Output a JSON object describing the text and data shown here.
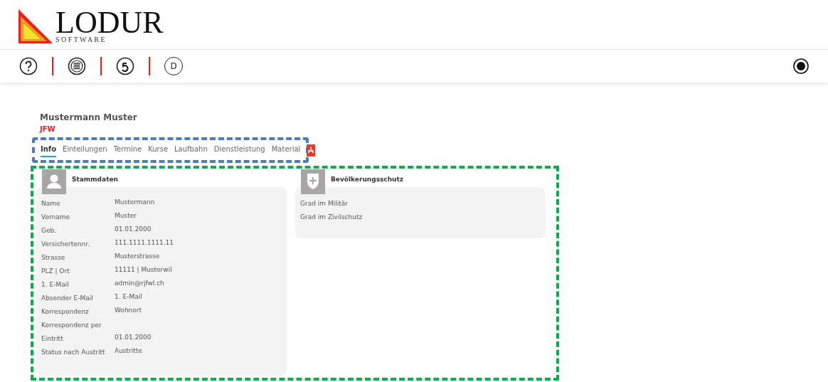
{
  "logo": {
    "name": "LODUR",
    "tagline": "S O F T W A R E"
  },
  "toolbar": {
    "buttons": [
      {
        "kind": "help"
      },
      {
        "kind": "list"
      },
      {
        "kind": "undo"
      },
      {
        "kind": "letter",
        "label": "D"
      }
    ],
    "record": {
      "kind": "record"
    }
  },
  "person": {
    "name": "Mustermann Muster",
    "unit": "JFW"
  },
  "tabs": [
    {
      "label": "Info",
      "selected": true,
      "kind": "text"
    },
    {
      "label": "Einteilungen",
      "selected": false,
      "kind": "text"
    },
    {
      "label": "Termine",
      "selected": false,
      "kind": "text"
    },
    {
      "label": "Kurse",
      "selected": false,
      "kind": "text"
    },
    {
      "label": "Laufbahn",
      "selected": false,
      "kind": "text"
    },
    {
      "label": "Dienstleistung",
      "selected": false,
      "kind": "text"
    },
    {
      "label": "Material",
      "selected": false,
      "kind": "text"
    },
    {
      "kind": "pdf",
      "selected": false
    }
  ],
  "cards": [
    {
      "title": "Stammdaten",
      "kind": "person",
      "rows": [
        {
          "label": "Name",
          "value": "Mustermann"
        },
        {
          "label": "Vorname",
          "value": "Muster"
        },
        {
          "label": "Geb.",
          "value": "01.01.2000"
        },
        {
          "label": "Versichertennr.",
          "value": "111.1111.1111.11"
        },
        {
          "label": "Strasse",
          "value": "Musterstrasse"
        },
        {
          "label": "PLZ | Ort",
          "value": "11111 | Musterwil"
        },
        {
          "label": "1. E-Mail",
          "value": "admin@rjfwl.ch"
        },
        {
          "label": "Absender E-Mail",
          "value": "1. E-Mail"
        },
        {
          "label": "Korrespondenz",
          "value": "Wohnort"
        },
        {
          "label": "Korrespondenz per"
        },
        {
          "label": "Eintritt",
          "value": "01.01.2000"
        },
        {
          "label": "Status nach Austritt",
          "value": "Austritte"
        }
      ]
    },
    {
      "title": "Bevölkerungsschutz",
      "kind": "shield",
      "rows": [
        {
          "label": "Grad im Militär"
        },
        {
          "label": "Grad im Zivilschutz"
        }
      ]
    }
  ]
}
